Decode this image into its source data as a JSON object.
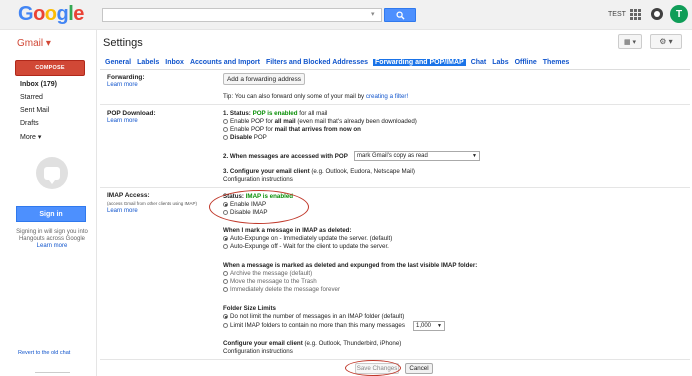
{
  "header": {
    "logo_letters": [
      {
        "ch": "G",
        "color": "#4285f4"
      },
      {
        "ch": "o",
        "color": "#ea4335"
      },
      {
        "ch": "o",
        "color": "#fbbc05"
      },
      {
        "ch": "g",
        "color": "#4285f4"
      },
      {
        "ch": "l",
        "color": "#34a853"
      },
      {
        "ch": "e",
        "color": "#ea4335"
      }
    ],
    "search_placeholder": "",
    "search_icon": "search-icon",
    "user_name": "TEST",
    "apps_icon": "apps-grid-icon",
    "notifications_icon": "notifications-icon",
    "avatar_initial": "T"
  },
  "subheader": {
    "app_label": "Gmail ▾",
    "page_title": "Settings",
    "view_button": "▦ ▾",
    "gear_button": "⚙ ▾"
  },
  "sidebar": {
    "compose_label": "COMPOSE",
    "items": [
      {
        "label": "Inbox (179)"
      },
      {
        "label": "Starred"
      },
      {
        "label": "Sent Mail"
      },
      {
        "label": "Drafts"
      },
      {
        "label": "More ▾"
      }
    ],
    "signin_label": "Sign in",
    "signin_note": "Signing in will sign you into Hangouts across Google",
    "signin_learn": "Learn more",
    "revert_link": "Revert to the old chat"
  },
  "tabs": [
    {
      "label": "General",
      "active": false
    },
    {
      "label": "Labels",
      "active": false
    },
    {
      "label": "Inbox",
      "active": false
    },
    {
      "label": "Accounts and Import",
      "active": false
    },
    {
      "label": "Filters and Blocked Addresses",
      "active": false
    },
    {
      "label": "Forwarding and POP/IMAP",
      "active": true
    },
    {
      "label": "Chat",
      "active": false
    },
    {
      "label": "Labs",
      "active": false
    },
    {
      "label": "Offline",
      "active": false
    },
    {
      "label": "Themes",
      "active": false
    }
  ],
  "forwarding": {
    "label": "Forwarding:",
    "learn_more": "Learn more",
    "add_button": "Add a forwarding address",
    "tip_text": "Tip: You can also forward only some of your mail by",
    "tip_link": "creating a filter!"
  },
  "pop": {
    "label": "POP Download:",
    "learn_more": "Learn more",
    "status_prefix": "1. Status: ",
    "status_value": "POP is enabled",
    "status_suffix": " for all mail",
    "opt1_pre": "Enable POP for ",
    "opt1_bold": "all mail",
    "opt1_post": " (even mail that's already been downloaded)",
    "opt2_pre": "Enable POP for ",
    "opt2_bold": "mail that arrives from now on",
    "opt3_pre": "",
    "opt3_bold": "Disable",
    "opt3_post": " POP",
    "when_label": "2. When messages are accessed with POP",
    "when_value": "mark Gmail's copy as read",
    "configure_label": "3. Configure your email client",
    "configure_hint": " (e.g. Outlook, Eudora, Netscape Mail)",
    "configure_link": "Configuration instructions"
  },
  "imap": {
    "label": "IMAP Access:",
    "sub_label": "(access Gmail from other clients using IMAP)",
    "learn_more": "Learn more",
    "status_prefix": "Status: ",
    "status_value": "IMAP is enabled",
    "enable": "Enable IMAP",
    "disable": "Disable IMAP",
    "deleted_title": "When I mark a message in IMAP as deleted:",
    "deleted_opt1": "Auto-Expunge on - Immediately update the server. (default)",
    "deleted_opt2": "Auto-Expunge off - Wait for the client to update the server.",
    "expunged_title": "When a message is marked as deleted and expunged from the last visible IMAP folder:",
    "expunged_opt1": "Archive the message (default)",
    "expunged_opt2": "Move the message to the Trash",
    "expunged_opt3": "Immediately delete the message forever",
    "folder_title": "Folder Size Limits",
    "folder_opt1": "Do not limit the number of messages in an IMAP folder (default)",
    "folder_opt2": "Limit IMAP folders to contain no more than this many messages",
    "folder_limit_value": "1,000",
    "client_label": "Configure your email client",
    "client_hint": " (e.g. Outlook, Thunderbird, iPhone)",
    "client_link": "Configuration instructions"
  },
  "footer": {
    "save": "Save Changes",
    "cancel": "Cancel"
  }
}
